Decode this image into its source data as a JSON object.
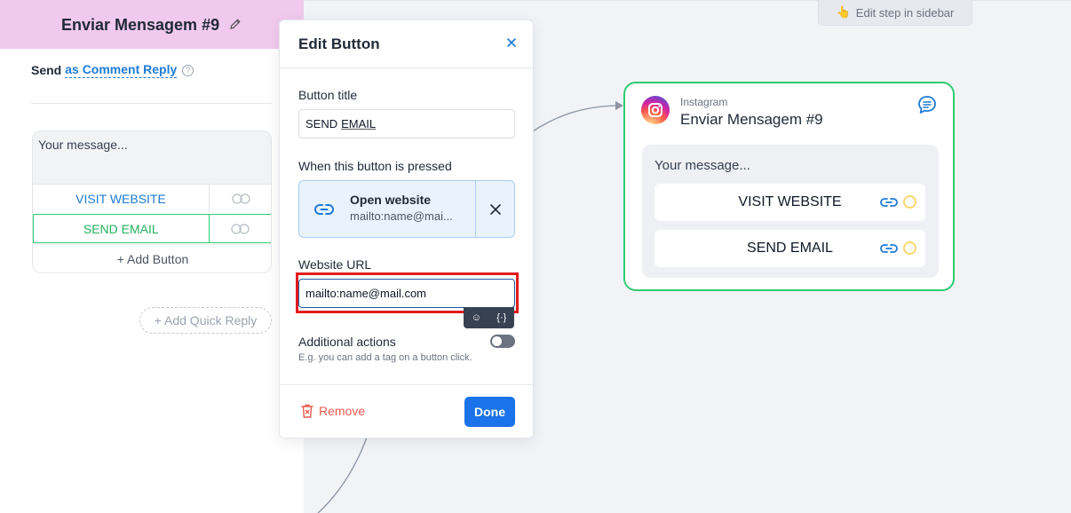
{
  "canvas": {
    "hint_chip": {
      "icon": "pointing-hand-icon",
      "label": "Edit step in sidebar"
    }
  },
  "flow_node": {
    "platform": "Instagram",
    "title": "Enviar Mensagem #9",
    "message": "Your message...",
    "buttons": [
      {
        "label": "VISIT WEBSITE"
      },
      {
        "label": "SEND EMAIL"
      }
    ],
    "border_color": "#2ecc71"
  },
  "left_panel": {
    "title": "Enviar Mensagem #9",
    "send_prefix": "Send",
    "send_mode": "as Comment Reply",
    "help_glyph": "?",
    "message_placeholder": "Your message...",
    "buttons": [
      {
        "label": "VISIT WEBSITE",
        "color": "#1d7bd6"
      },
      {
        "label": "SEND EMAIL",
        "color": "#22b35e",
        "selected": true
      }
    ],
    "add_button": "+ Add Button",
    "add_quick_reply": "+ Add Quick Reply"
  },
  "modal": {
    "title": "Edit Button",
    "button_title_label": "Button title",
    "button_title_value_1": "SEND",
    "button_title_value_2": "EMAIL",
    "pressed_label": "When this button is pressed",
    "action": {
      "name": "Open website",
      "value": "mailto:name@mai..."
    },
    "url_label": "Website URL",
    "url_value": "mailto:name@mail.com",
    "tools": {
      "emoji": "☺",
      "variable": "{·}"
    },
    "additional_label": "Additional actions",
    "additional_hint": "E.g. you can add a tag on a button click.",
    "additional_enabled": false,
    "remove_label": "Remove",
    "done_label": "Done"
  },
  "colors": {
    "accent": "#1a73e8",
    "success": "#2ecc71",
    "danger": "#e65c4f",
    "header_bg": "#f1c9ee",
    "highlight": "#e21b1b"
  }
}
